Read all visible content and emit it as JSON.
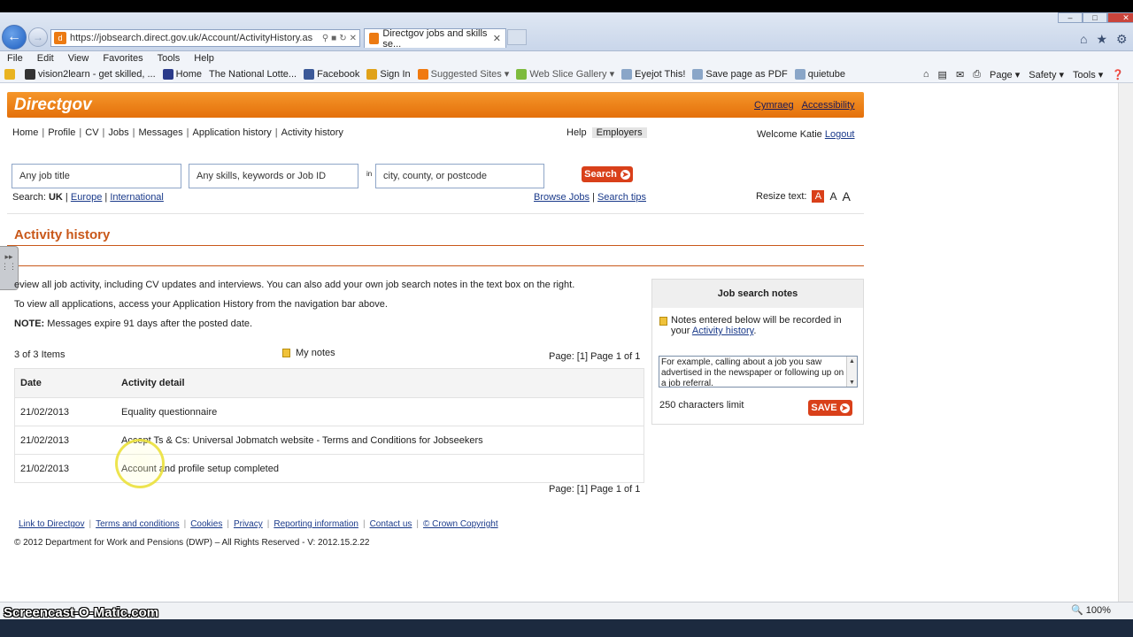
{
  "browser": {
    "url": "https://jobsearch.direct.gov.uk/Account/ActivityHistory.as",
    "tab_title": "Directgov jobs and skills se...",
    "menu": [
      "File",
      "Edit",
      "View",
      "Favorites",
      "Tools",
      "Help"
    ],
    "favorites": [
      "vision2learn - get skilled, ...",
      "Home",
      "The National Lotte...",
      "Facebook",
      "Sign In",
      "Suggested Sites ▾",
      "Web Slice Gallery ▾",
      "Eyejot This!",
      "Save page as PDF",
      "quietube"
    ],
    "command_bar": [
      "Page ▾",
      "Safety ▾",
      "Tools ▾"
    ],
    "zoom": "100%",
    "watermark": "Screencast-O-Matic.com"
  },
  "site": {
    "logo": "Directgov",
    "lang_links": [
      "Cymraeg",
      "Accessibility"
    ],
    "nav": [
      "Home",
      "Profile",
      "CV",
      "Jobs",
      "Messages",
      "Application history",
      "Activity history"
    ],
    "help": "Help",
    "employers": "Employers",
    "welcome": "Welcome Katie",
    "logout": "Logout"
  },
  "search": {
    "job_placeholder": "Any job title",
    "keywords_placeholder": "Any skills, keywords or Job ID",
    "in_label": "in",
    "location_placeholder": "city, county, or postcode",
    "button": "Search",
    "scope_label": "Search:",
    "scope_uk": "UK",
    "scope_europe": "Europe",
    "scope_international": "International",
    "browse_jobs": "Browse Jobs",
    "search_tips": "Search tips",
    "resize_label": "Resize text:",
    "resize_a": "A"
  },
  "main": {
    "heading": "Activity history",
    "intro": "Review all job activity, including CV updates and interviews. You can also add your own job search notes in the text box on the right.",
    "intro_visible": "eview all job activity, including CV updates and interviews. You can also add your own job search notes in the text box on the right.",
    "view_all": "To view all applications, access your Application History from the navigation bar above.",
    "note_label": "NOTE:",
    "note_text": "Messages expire 91 days after the posted date.",
    "items_count": "3 of 3 Items",
    "my_notes": "My notes",
    "pager": "Page: [1] Page 1 of 1",
    "table": {
      "headers": [
        "Date",
        "Activity detail"
      ],
      "rows": [
        [
          "21/02/2013",
          "Equality questionnaire"
        ],
        [
          "21/02/2013",
          "Accept Ts & Cs: Universal Jobmatch website - Terms and Conditions for Jobseekers"
        ],
        [
          "21/02/2013",
          "Account and profile setup completed"
        ]
      ]
    }
  },
  "notes": {
    "title": "Job search notes",
    "info_prefix": "Notes entered below will be recorded in your",
    "info_link": "Activity history",
    "textarea": "For example, calling about a job you saw advertised in the newspaper or following up on a job referral.",
    "limit": "250 characters limit",
    "save": "SAVE"
  },
  "footer": {
    "links": [
      "Link to Directgov",
      "Terms and conditions",
      "Cookies",
      "Privacy",
      "Reporting information",
      "Contact us",
      "© Crown Copyright"
    ],
    "copyright": "© 2012 Department for Work and Pensions (DWP) – All Rights Reserved - V: 2012.15.2.22"
  },
  "colors": {
    "accent": "#e4700b",
    "button": "#d9401a",
    "heading": "#c9581a"
  }
}
